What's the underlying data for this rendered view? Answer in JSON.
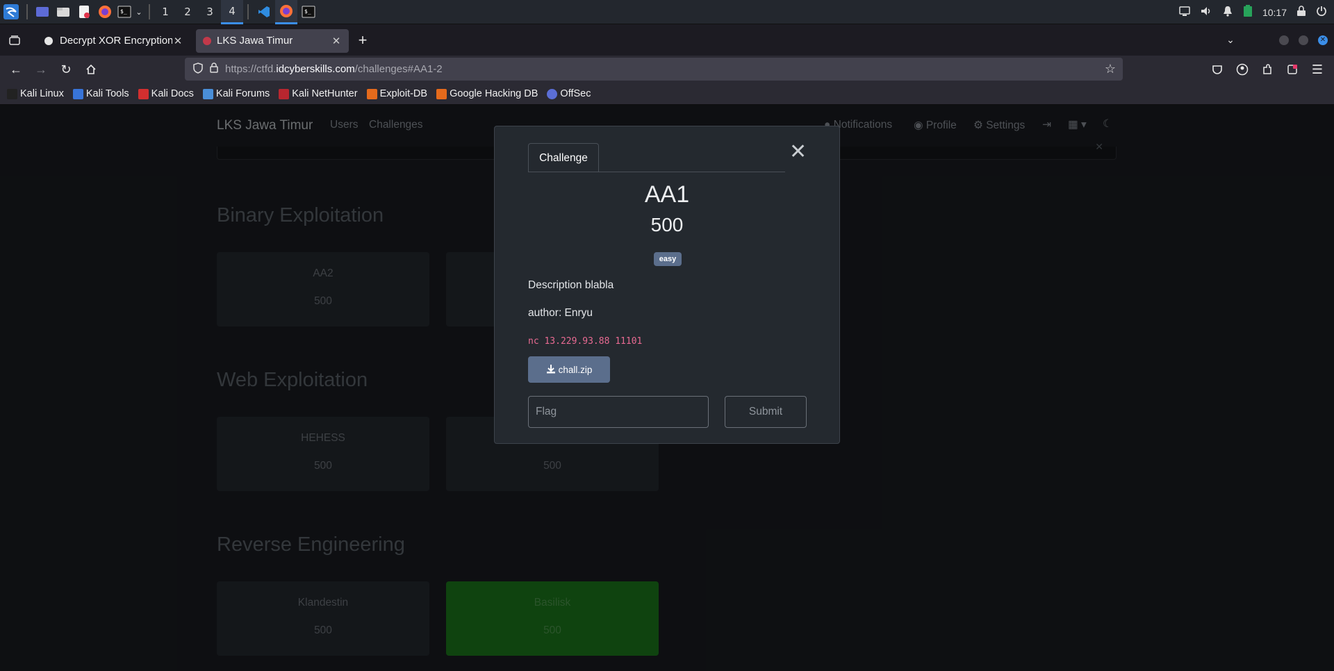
{
  "taskbar": {
    "workspaces": [
      "1",
      "2",
      "3",
      "4"
    ],
    "active_workspace": "4",
    "clock": "10:17",
    "icons": [
      "kali-menu-icon",
      "desktop-icon",
      "files-icon",
      "text-editor-icon",
      "firefox-icon",
      "terminal-icon",
      "vscode-icon",
      "firefox-running-icon",
      "terminal-running-icon",
      "screen-icon",
      "volume-icon",
      "bell-icon",
      "battery-icon",
      "lock-icon",
      "power-icon"
    ]
  },
  "browser": {
    "tabs": [
      {
        "title": "Decrypt XOR Encryption",
        "active": false
      },
      {
        "title": "LKS Jawa Timur",
        "active": true
      }
    ],
    "url_prefix": "https://ctfd.",
    "url_domain": "idcyberskills.com",
    "url_path": "/challenges#AA1-2",
    "bookmarks": [
      "Kali Linux",
      "Kali Tools",
      "Kali Docs",
      "Kali Forums",
      "Kali NetHunter",
      "Exploit-DB",
      "Google Hacking DB",
      "OffSec"
    ]
  },
  "site": {
    "brand": "LKS Jawa Timur",
    "nav_left": [
      "Users",
      "Challenges"
    ],
    "nav_right": [
      "Notifications",
      "Profile",
      "Settings"
    ]
  },
  "categories": [
    {
      "title": "Binary Exploitation",
      "cards": [
        {
          "name": "AA2",
          "value": "500",
          "solved": false
        },
        {
          "name": "",
          "value": "",
          "solved": false
        }
      ]
    },
    {
      "title": "Web Exploitation",
      "cards": [
        {
          "name": "HEHESS",
          "value": "500",
          "solved": false
        },
        {
          "name": "",
          "value": "500",
          "solved": false
        }
      ]
    },
    {
      "title": "Reverse Engineering",
      "cards": [
        {
          "name": "Klandestin",
          "value": "500",
          "solved": false
        },
        {
          "name": "Basilisk",
          "value": "500",
          "solved": true
        }
      ]
    }
  ],
  "modal": {
    "tab_label": "Challenge",
    "name": "AA1",
    "value": "500",
    "badge": "easy",
    "description": "Description blabla",
    "author": "author: Enryu",
    "connection": "nc 13.229.93.88 11101",
    "file_label": "chall.zip",
    "flag_placeholder": "Flag",
    "submit_label": "Submit"
  }
}
